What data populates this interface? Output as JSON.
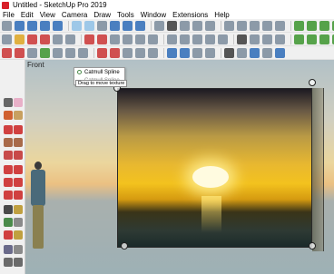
{
  "window": {
    "title": "Untitled - SketchUp Pro 2019"
  },
  "menu": [
    "File",
    "Edit",
    "View",
    "Camera",
    "Draw",
    "Tools",
    "Window",
    "Extensions",
    "Help"
  ],
  "viewport": {
    "label": "Front"
  },
  "tooltip": {
    "primary": "Catmull Spline",
    "secondary": "Catmull Spline"
  },
  "hint": "Drag to move texture"
}
